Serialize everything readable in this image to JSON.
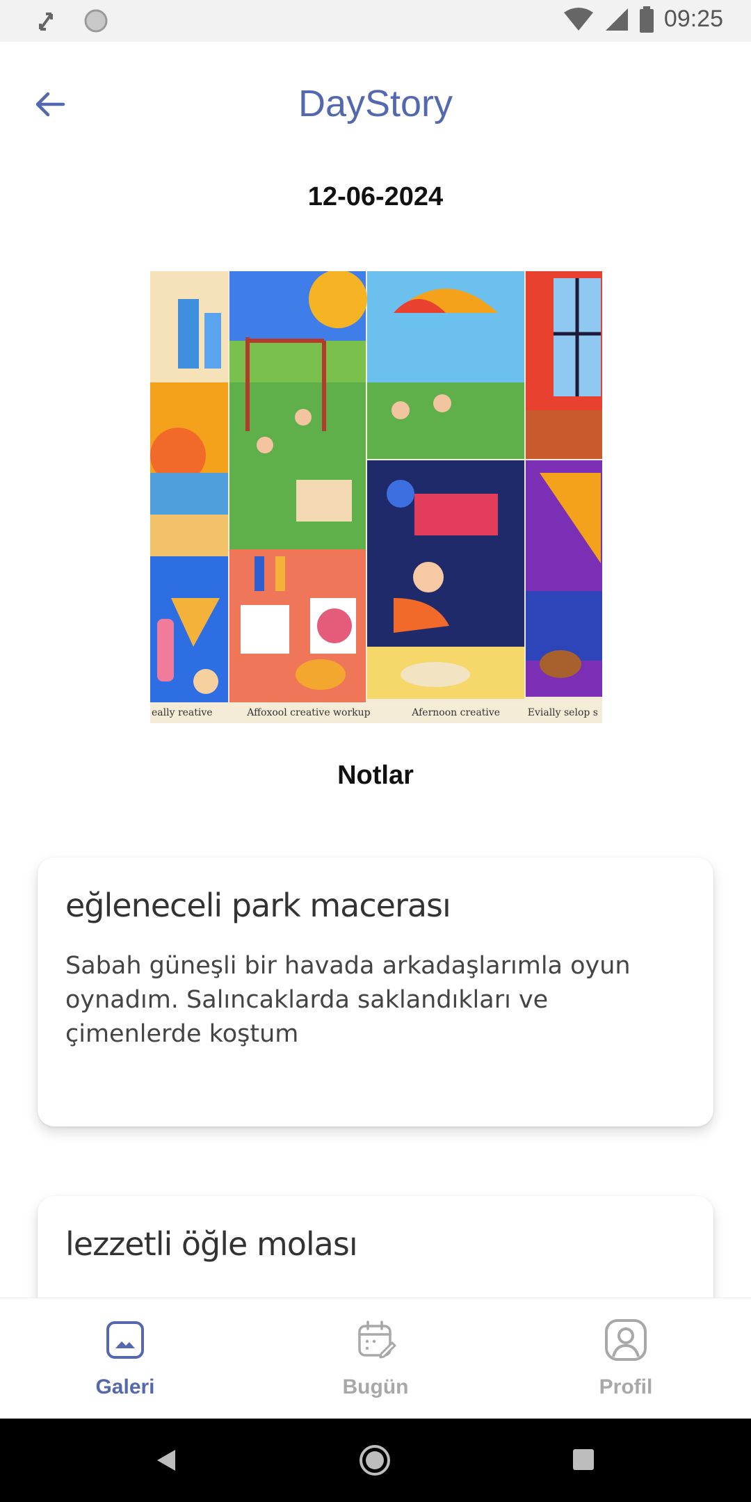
{
  "status_bar": {
    "time": "09:25"
  },
  "app_bar": {
    "title": "DayStory"
  },
  "entry": {
    "date": "12-06-2024",
    "image_captions": [
      "eally reative",
      "Affoxool creative workup",
      "Afernoon creative",
      "Evially selop s"
    ]
  },
  "notes": {
    "heading": "Notlar",
    "items": [
      {
        "title": "eğleneceli park macerası",
        "body": "Sabah güneşli bir havada arkadaşlarımla oyun oynadım. Salıncaklarda saklandıkları ve çimenlerde koştum"
      },
      {
        "title": "lezzetli öğle molası",
        "body": ""
      }
    ]
  },
  "bottom_nav": {
    "items": [
      {
        "label": "Galeri",
        "active": true
      },
      {
        "label": "Bugün",
        "active": false
      },
      {
        "label": "Profil",
        "active": false
      }
    ]
  },
  "colors": {
    "accent": "#5468b0",
    "inactive": "#a8a8a8"
  }
}
